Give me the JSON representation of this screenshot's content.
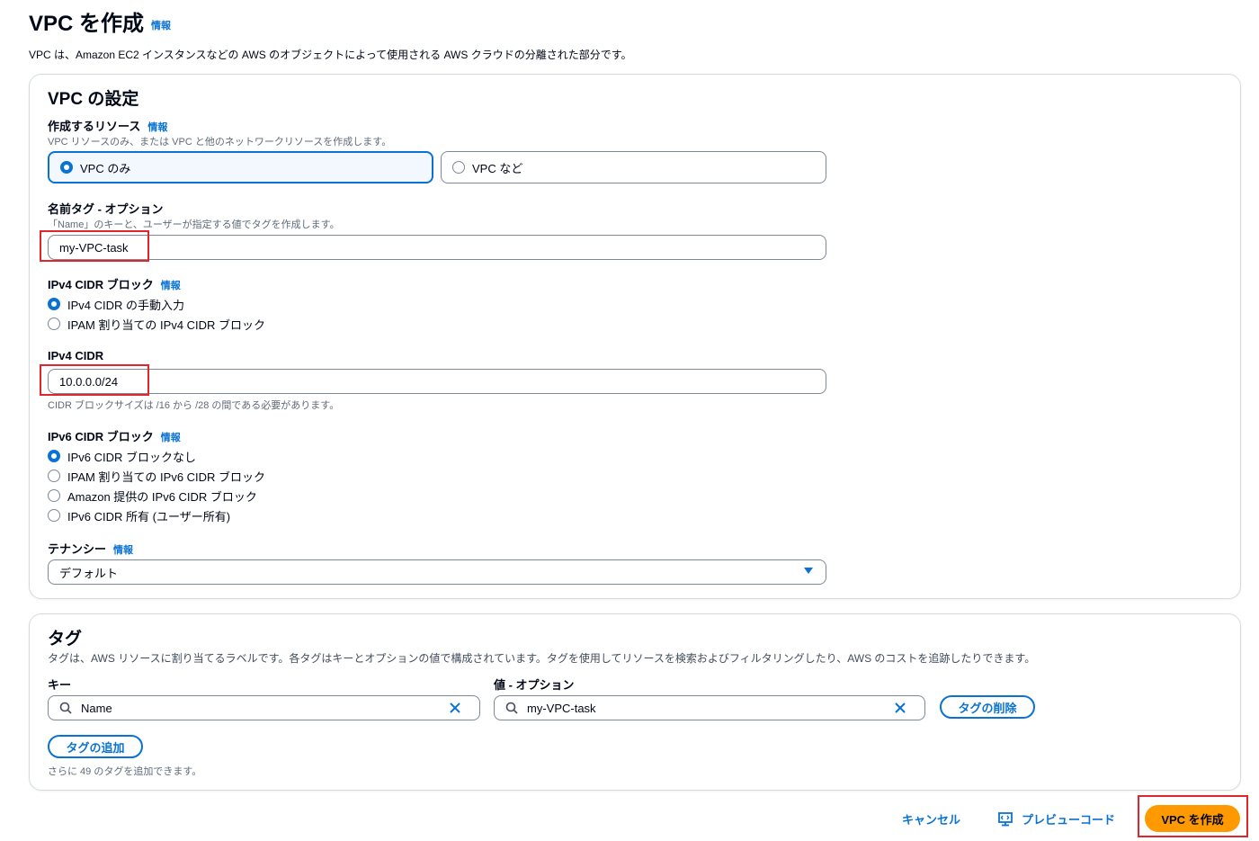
{
  "page": {
    "title": "VPC を作成",
    "info": "情報",
    "description": "VPC は、Amazon EC2 インスタンスなどの AWS のオブジェクトによって使用される AWS クラウドの分離された部分です。"
  },
  "vpc_settings": {
    "heading": "VPC の設定",
    "resources": {
      "label": "作成するリソース",
      "info": "情報",
      "hint": "VPC リソースのみ、または VPC と他のネットワークリソースを作成します。",
      "options": [
        "VPC のみ",
        "VPC など"
      ],
      "selected": "VPC のみ"
    },
    "name_tag": {
      "label": "名前タグ - オプション",
      "hint": "「Name」のキーと、ユーザーが指定する値でタグを作成します。",
      "value": "my-VPC-task"
    },
    "ipv4_block": {
      "label": "IPv4 CIDR ブロック",
      "info": "情報",
      "options": [
        "IPv4 CIDR の手動入力",
        "IPAM 割り当ての IPv4 CIDR ブロック"
      ],
      "selected": "IPv4 CIDR の手動入力"
    },
    "ipv4_cidr": {
      "label": "IPv4 CIDR",
      "value": "10.0.0.0/24",
      "hint": "CIDR ブロックサイズは /16 から /28 の間である必要があります。"
    },
    "ipv6_block": {
      "label": "IPv6 CIDR ブロック",
      "info": "情報",
      "options": [
        "IPv6 CIDR ブロックなし",
        "IPAM 割り当ての IPv6 CIDR ブロック",
        "Amazon 提供の IPv6 CIDR ブロック",
        "IPv6 CIDR 所有 (ユーザー所有)"
      ],
      "selected": "IPv6 CIDR ブロックなし"
    },
    "tenancy": {
      "label": "テナンシー",
      "info": "情報",
      "value": "デフォルト"
    }
  },
  "tags": {
    "heading": "タグ",
    "description": "タグは、AWS リソースに割り当てるラベルです。各タグはキーとオプションの値で構成されています。タグを使用してリソースを検索およびフィルタリングしたり、AWS のコストを追跡したりできます。",
    "key_label": "キー",
    "value_label": "値 - オプション",
    "key_value": "Name",
    "value_value": "my-VPC-task",
    "remove_label": "タグの削除",
    "add_label": "タグの追加",
    "remaining_hint": "さらに 49 のタグを追加できます。"
  },
  "footer": {
    "cancel": "キャンセル",
    "preview": "プレビューコード",
    "create": "VPC を作成"
  },
  "colors": {
    "accent": "#0972d3",
    "primary_button": "#ff9900",
    "highlight": "#e0252b"
  }
}
